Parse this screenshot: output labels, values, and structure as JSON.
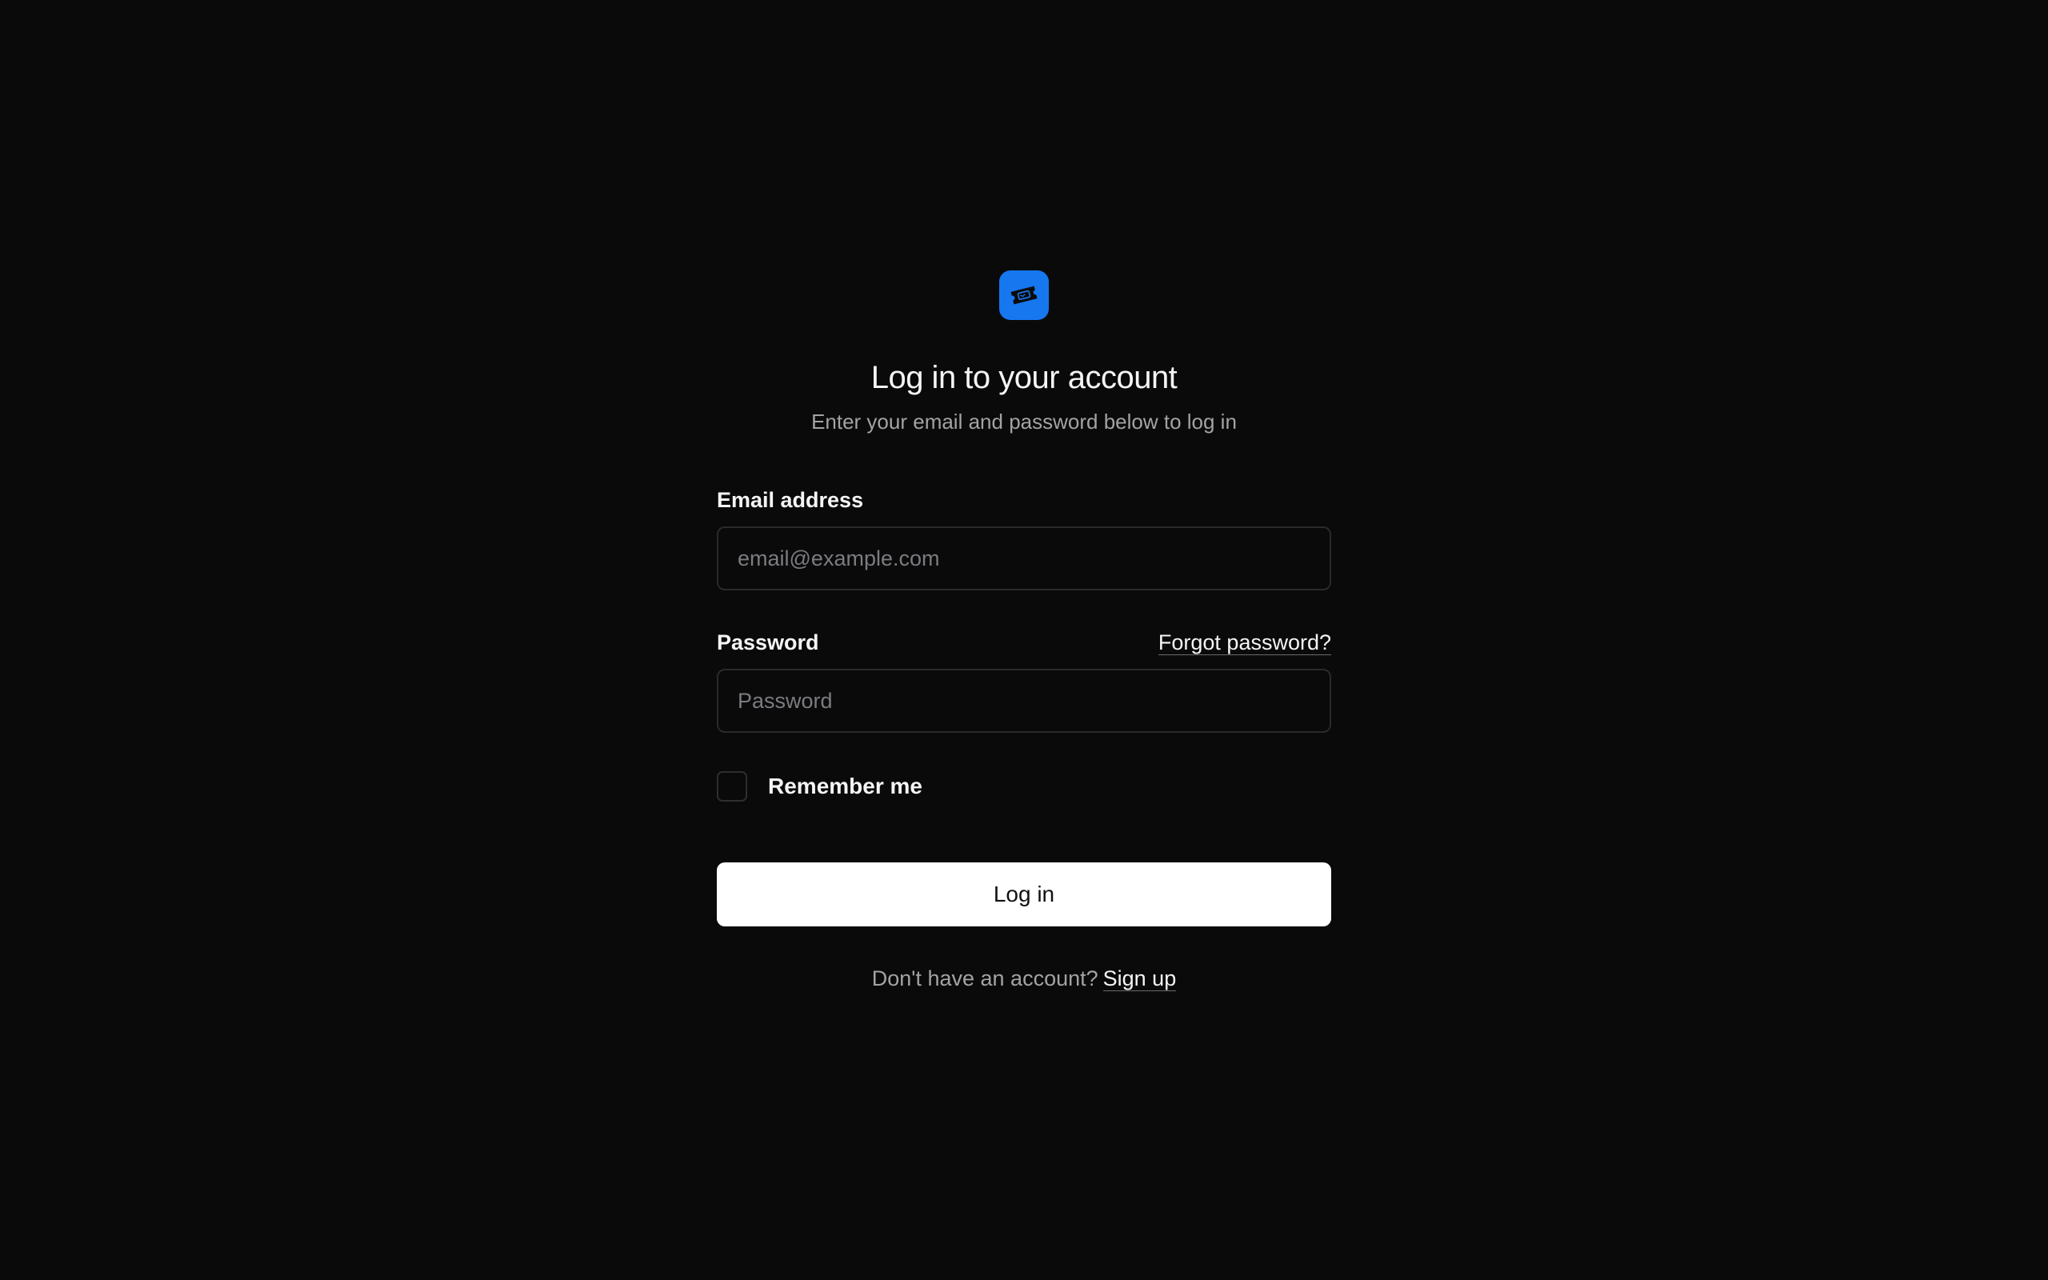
{
  "app": {
    "logo_icon": "ticket-icon",
    "brand_color": "#1677ef"
  },
  "header": {
    "title": "Log in to your account",
    "subtitle": "Enter your email and password below to log in"
  },
  "form": {
    "email": {
      "label": "Email address",
      "value": "",
      "placeholder": "email@example.com"
    },
    "password": {
      "label": "Password",
      "value": "",
      "placeholder": "Password",
      "forgot_label": "Forgot password?"
    },
    "remember": {
      "label": "Remember me",
      "checked": false
    },
    "submit_label": "Log in"
  },
  "footer": {
    "prompt": "Don't have an account?",
    "signup_label": "Sign up"
  }
}
